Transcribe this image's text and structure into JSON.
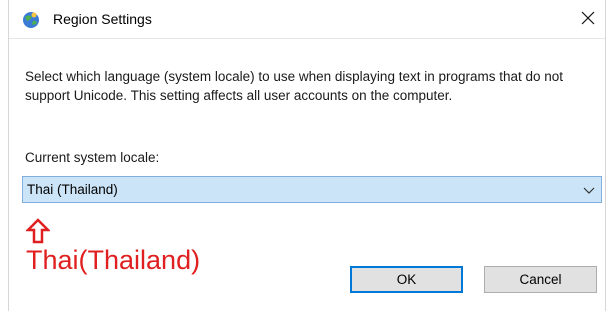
{
  "window": {
    "title": "Region Settings"
  },
  "dialog": {
    "description": "Select which language (system locale) to use when displaying text in programs that do not support Unicode. This setting affects all user accounts on the computer.",
    "locale_label": "Current system locale:",
    "locale_value": "Thai (Thailand)"
  },
  "annotation": {
    "text": "Thai(Thailand)",
    "color": "#e02020"
  },
  "buttons": {
    "ok": "OK",
    "cancel": "Cancel"
  },
  "colors": {
    "select_background": "#cce4f7",
    "select_border": "#7fb0e0",
    "ok_focus_border": "#0078d7"
  }
}
